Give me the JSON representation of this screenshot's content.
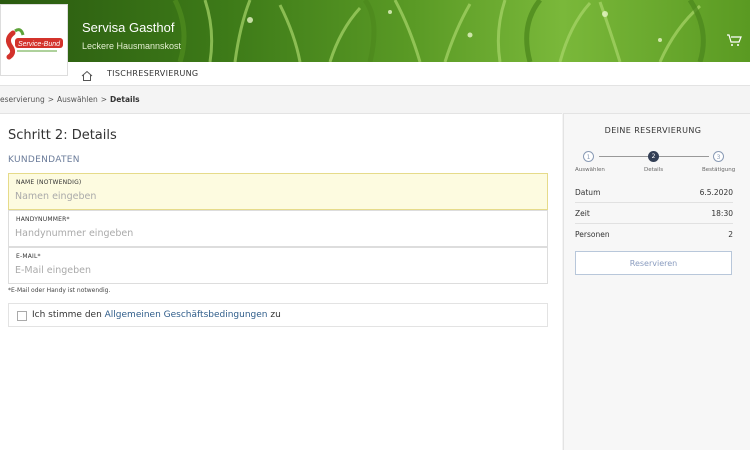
{
  "header": {
    "logo_text": "Service-Bund",
    "brand_title": "Servisa Gasthof",
    "brand_subtitle": "Leckere Hausmannskost",
    "cart_icon": "cart-icon",
    "home_icon": "home-icon"
  },
  "nav": {
    "tab_label": "TISCHRESERVIERUNG"
  },
  "breadcrumb": {
    "items": [
      "eservierung",
      "Auswählen",
      "Details"
    ],
    "separator": ">"
  },
  "form": {
    "step_title": "Schritt 2: Details",
    "section_title": "KUNDENDATEN",
    "fields": [
      {
        "label": "NAME (NOTWENDIG)",
        "placeholder": "Namen eingeben",
        "value": ""
      },
      {
        "label": "HANDYNUMMER*",
        "placeholder": "Handynummer eingeben",
        "value": ""
      },
      {
        "label": "E-MAIL*",
        "placeholder": "E-Mail eingeben",
        "value": ""
      }
    ],
    "note": "*E-Mail oder Handy ist notwendig.",
    "terms": {
      "prefix": "Ich stimme den ",
      "link": "Allgemeinen Geschäftsbedingungen",
      "suffix": " zu",
      "checked": false
    }
  },
  "summary": {
    "title": "DEINE RESERVIERUNG",
    "steps": [
      {
        "number": "1",
        "label": "Auswählen",
        "state": "todo"
      },
      {
        "number": "2",
        "label": "Details",
        "state": "current"
      },
      {
        "number": "3",
        "label": "Bestätigung",
        "state": "todo"
      }
    ],
    "rows": [
      {
        "key": "Datum",
        "value": "6.5.2020"
      },
      {
        "key": "Zeit",
        "value": "18:30"
      },
      {
        "key": "Personen",
        "value": "2"
      }
    ],
    "button_label": "Reservieren"
  },
  "colors": {
    "accent": "#2f5d8a",
    "section": "#6b7c9a",
    "highlight": "#fdfbe0",
    "step_current": "#333f55"
  }
}
